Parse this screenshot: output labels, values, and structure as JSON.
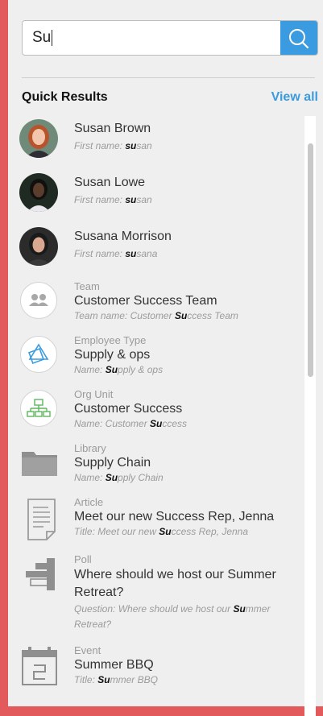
{
  "search": {
    "value": "Su"
  },
  "header": {
    "title": "Quick Results",
    "view_all": "View all"
  },
  "results": [
    {
      "type": "",
      "name": "Susan Brown",
      "sub_prefix": "First name: ",
      "sub_match": "su",
      "sub_rest": "san",
      "icon": "avatar-icon"
    },
    {
      "type": "",
      "name": "Susan Lowe",
      "sub_prefix": "First name: ",
      "sub_match": "su",
      "sub_rest": "san",
      "icon": "avatar-icon"
    },
    {
      "type": "",
      "name": "Susana Morrison",
      "sub_prefix": "First name: ",
      "sub_match": "su",
      "sub_rest": "sana",
      "icon": "avatar-icon"
    },
    {
      "type": "Team",
      "name": "Customer Success Team",
      "sub_prefix": "Team name: Customer ",
      "sub_match": "Su",
      "sub_rest": "ccess Team",
      "icon": "team-icon"
    },
    {
      "type": "Employee Type",
      "name": "Supply & ops",
      "sub_prefix": "Name: ",
      "sub_match": "Su",
      "sub_rest": "pply & ops",
      "icon": "employee-type-icon"
    },
    {
      "type": "Org Unit",
      "name": "Customer Success",
      "sub_prefix": "Name: Customer ",
      "sub_match": "Su",
      "sub_rest": "ccess",
      "icon": "org-chart-icon"
    },
    {
      "type": "Library",
      "name": "Supply Chain",
      "sub_prefix": "Name: ",
      "sub_match": "Su",
      "sub_rest": "pply Chain",
      "icon": "folder-icon"
    },
    {
      "type": "Article",
      "name": "Meet our new Success Rep, Jenna",
      "sub_prefix": "Title: Meet our new ",
      "sub_match": "Su",
      "sub_rest": "ccess Rep, Jenna",
      "icon": "article-icon"
    },
    {
      "type": "Poll",
      "name": "Where should we host our Summer Retreat?",
      "sub_prefix": "Question: Where should we host our ",
      "sub_match": "Su",
      "sub_rest": "mmer Retreat?",
      "icon": "poll-icon"
    },
    {
      "type": "Event",
      "name": "Summer BBQ",
      "sub_prefix": "Title: ",
      "sub_match": "Su",
      "sub_rest": "mmer BBQ",
      "icon": "calendar-icon"
    }
  ]
}
